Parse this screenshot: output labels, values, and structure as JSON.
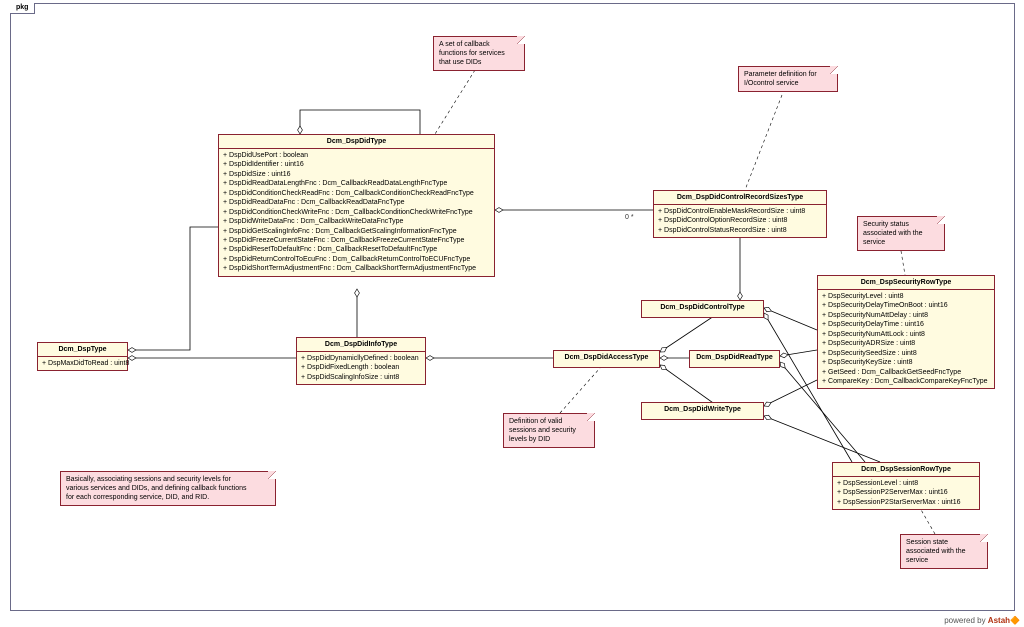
{
  "package_label": "pkg",
  "footer": {
    "prefix": "powered by ",
    "brand": "Astah",
    "suffix": "🔶"
  },
  "notes": {
    "callback": "A set of callback\nfunctions for services\nthat use DIDs",
    "param": "Parameter definition for\nI/Ocontrol service",
    "security": "Security status\nassociated with the\nservice",
    "valid": "Definition of valid\nsessions and security\nlevels by DID",
    "explain": "Basically, associating sessions and security levels for\nvarious services and DIDs, and defining callback functions\nfor each corresponding service, DID, and RID.",
    "session": "Session state\nassociated with the\nservice"
  },
  "multiplicities": {
    "zero_star": "0   *"
  },
  "classes": {
    "DspDidType": {
      "name": "Dcm_DspDidType",
      "attrs": [
        "+ DspDidUsePort : boolean",
        "+ DspDidIdentifier : uint16",
        "+ DspDidSize : uint16",
        "+ DspDidReadDataLengthFnc : Dcm_CallbackReadDataLengthFncType",
        "+ DspDidConditionCheckReadFnc : Dcm_CallbackConditionCheckReadFncType",
        "+ DspDidReadDataFnc : Dcm_CallbackReadDataFncType",
        "+ DspDidConditionCheckWriteFnc : Dcm_CallbackConditionCheckWriteFncType",
        "+ DspDidWriteDataFnc : Dcm_CallbackWriteDataFncType",
        "+ DspDidGetScalingInfoFnc : Dcm_CallbackGetScalingInformationFncType",
        "+ DspDidFreezeCurrentStateFnc : Dcm_CallbackFreezeCurrentStateFncType",
        "+ DspDidResetToDefaultFnc : Dcm_CallbackResetToDefaultFncType",
        "+ DspDidReturnControlToEcuFnc : Dcm_CallbackReturnControlToECUFncType",
        "+ DspDidShortTermAdjustmentFnc : Dcm_CallbackShortTermAdjustmentFncType"
      ]
    },
    "DspType": {
      "name": "Dcm_DspType",
      "attrs": [
        "+ DspMaxDidToRead : uint8"
      ]
    },
    "DspDidInfoType": {
      "name": "Dcm_DspDidInfoType",
      "attrs": [
        "+ DspDidDynamicllyDefined : boolean",
        "+ DspDidFixedLength : boolean",
        "+ DspDidScalingInfoSize : uint8"
      ]
    },
    "DspDidControlRecordSizesType": {
      "name": "Dcm_DspDidControlRecordSizesType",
      "attrs": [
        "+ DspDidControlEnableMaskRecordSize : uint8",
        "+ DspDidControlOptionRecordSize : uint8",
        "+ DspDidControlStatusRecordSize : uint8"
      ]
    },
    "DspDidAccessType": {
      "name": "Dcm_DspDidAccessType"
    },
    "DspDidControlType": {
      "name": "Dcm_DspDidControlType"
    },
    "DspDidReadType": {
      "name": "Dcm_DspDidReadType"
    },
    "DspDidWriteType": {
      "name": "Dcm_DspDidWriteType"
    },
    "DspSecurityRowType": {
      "name": "Dcm_DspSecurityRowType",
      "attrs": [
        "+ DspSecurityLevel : uint8",
        "+ DspSecurityDelayTimeOnBoot : uint16",
        "+ DspSecurityNumAttDelay : uint8",
        "+ DspSecurityDelayTime : uint16",
        "+ DspSecurityNumAttLock : uint8",
        "+ DspSecurityADRSize : uint8",
        "+ DspSecuritySeedSize : uint8",
        "+ DspSecurityKeySize : uint8",
        "+ GetSeed : Dcm_CallbackGetSeedFncType",
        "+ CompareKey : Dcm_CallbackCompareKeyFncType"
      ]
    },
    "DspSessionRowType": {
      "name": "Dcm_DspSessionRowType",
      "attrs": [
        "+ DspSessionLevel : uint8",
        "+ DspSessionP2ServerMax : uint16",
        "+ DspSessionP2StarServerMax : uint16"
      ]
    }
  },
  "chart_data": {
    "type": "uml-class-diagram",
    "package": "pkg",
    "classes": [
      {
        "id": "Dcm_DspType",
        "attributes": [
          "DspMaxDidToRead : uint8"
        ]
      },
      {
        "id": "Dcm_DspDidType",
        "attributes": [
          "DspDidUsePort : boolean",
          "DspDidIdentifier : uint16",
          "DspDidSize : uint16",
          "DspDidReadDataLengthFnc : Dcm_CallbackReadDataLengthFncType",
          "DspDidConditionCheckReadFnc : Dcm_CallbackConditionCheckReadFncType",
          "DspDidReadDataFnc : Dcm_CallbackReadDataFncType",
          "DspDidConditionCheckWriteFnc : Dcm_CallbackConditionCheckWriteFncType",
          "DspDidWriteDataFnc : Dcm_CallbackWriteDataFncType",
          "DspDidGetScalingInfoFnc : Dcm_CallbackGetScalingInformationFncType",
          "DspDidFreezeCurrentStateFnc : Dcm_CallbackFreezeCurrentStateFncType",
          "DspDidResetToDefaultFnc : Dcm_CallbackResetToDefaultFncType",
          "DspDidReturnControlToEcuFnc : Dcm_CallbackReturnControlToECUFncType",
          "DspDidShortTermAdjustmentFnc : Dcm_CallbackShortTermAdjustmentFncType"
        ]
      },
      {
        "id": "Dcm_DspDidInfoType",
        "attributes": [
          "DspDidDynamicllyDefined : boolean",
          "DspDidFixedLength : boolean",
          "DspDidScalingInfoSize : uint8"
        ]
      },
      {
        "id": "Dcm_DspDidControlRecordSizesType",
        "attributes": [
          "DspDidControlEnableMaskRecordSize : uint8",
          "DspDidControlOptionRecordSize : uint8",
          "DspDidControlStatusRecordSize : uint8"
        ]
      },
      {
        "id": "Dcm_DspDidAccessType",
        "attributes": []
      },
      {
        "id": "Dcm_DspDidControlType",
        "attributes": []
      },
      {
        "id": "Dcm_DspDidReadType",
        "attributes": []
      },
      {
        "id": "Dcm_DspDidWriteType",
        "attributes": []
      },
      {
        "id": "Dcm_DspSecurityRowType",
        "attributes": [
          "DspSecurityLevel : uint8",
          "DspSecurityDelayTimeOnBoot : uint16",
          "DspSecurityNumAttDelay : uint8",
          "DspSecurityDelayTime : uint16",
          "DspSecurityNumAttLock : uint8",
          "DspSecurityADRSize : uint8",
          "DspSecuritySeedSize : uint8",
          "DspSecurityKeySize : uint8",
          "GetSeed : Dcm_CallbackGetSeedFncType",
          "CompareKey : Dcm_CallbackCompareKeyFncType"
        ]
      },
      {
        "id": "Dcm_DspSessionRowType",
        "attributes": [
          "DspSessionLevel : uint8",
          "DspSessionP2ServerMax : uint16",
          "DspSessionP2StarServerMax : uint16"
        ]
      }
    ],
    "relations": [
      {
        "from": "Dcm_DspType",
        "to": "Dcm_DspDidType",
        "kind": "aggregation"
      },
      {
        "from": "Dcm_DspType",
        "to": "Dcm_DspDidInfoType",
        "kind": "aggregation"
      },
      {
        "from": "Dcm_DspDidType",
        "to": "Dcm_DspDidType",
        "kind": "aggregation",
        "self": true
      },
      {
        "from": "Dcm_DspDidType",
        "to": "Dcm_DspDidInfoType",
        "kind": "aggregation"
      },
      {
        "from": "Dcm_DspDidType",
        "to": "Dcm_DspDidControlRecordSizesType",
        "kind": "aggregation",
        "multiplicity": "0..*"
      },
      {
        "from": "Dcm_DspDidInfoType",
        "to": "Dcm_DspDidAccessType",
        "kind": "aggregation"
      },
      {
        "from": "Dcm_DspDidAccessType",
        "to": "Dcm_DspDidControlType",
        "kind": "aggregation"
      },
      {
        "from": "Dcm_DspDidAccessType",
        "to": "Dcm_DspDidReadType",
        "kind": "aggregation"
      },
      {
        "from": "Dcm_DspDidAccessType",
        "to": "Dcm_DspDidWriteType",
        "kind": "aggregation"
      },
      {
        "from": "Dcm_DspDidControlType",
        "to": "Dcm_DspDidControlRecordSizesType",
        "kind": "aggregation"
      },
      {
        "from": "Dcm_DspDidControlType",
        "to": "Dcm_DspSecurityRowType",
        "kind": "aggregation"
      },
      {
        "from": "Dcm_DspDidControlType",
        "to": "Dcm_DspSessionRowType",
        "kind": "aggregation"
      },
      {
        "from": "Dcm_DspDidReadType",
        "to": "Dcm_DspSecurityRowType",
        "kind": "aggregation"
      },
      {
        "from": "Dcm_DspDidReadType",
        "to": "Dcm_DspSessionRowType",
        "kind": "aggregation"
      },
      {
        "from": "Dcm_DspDidWriteType",
        "to": "Dcm_DspSecurityRowType",
        "kind": "aggregation"
      },
      {
        "from": "Dcm_DspDidWriteType",
        "to": "Dcm_DspSessionRowType",
        "kind": "aggregation"
      }
    ],
    "notes": [
      {
        "text": "A set of callback functions for services that use DIDs",
        "attached_to": "Dcm_DspDidType"
      },
      {
        "text": "Parameter definition for I/Ocontrol service",
        "attached_to": "Dcm_DspDidControlRecordSizesType"
      },
      {
        "text": "Security status associated with the service",
        "attached_to": "Dcm_DspSecurityRowType"
      },
      {
        "text": "Definition of valid sessions and security levels by DID",
        "attached_to": "Dcm_DspDidAccessType"
      },
      {
        "text": "Session state associated with the service",
        "attached_to": "Dcm_DspSessionRowType"
      },
      {
        "text": "Basically, associating sessions and security levels for various services and DIDs, and defining callback functions for each corresponding service, DID, and RID.",
        "attached_to": null
      }
    ]
  }
}
